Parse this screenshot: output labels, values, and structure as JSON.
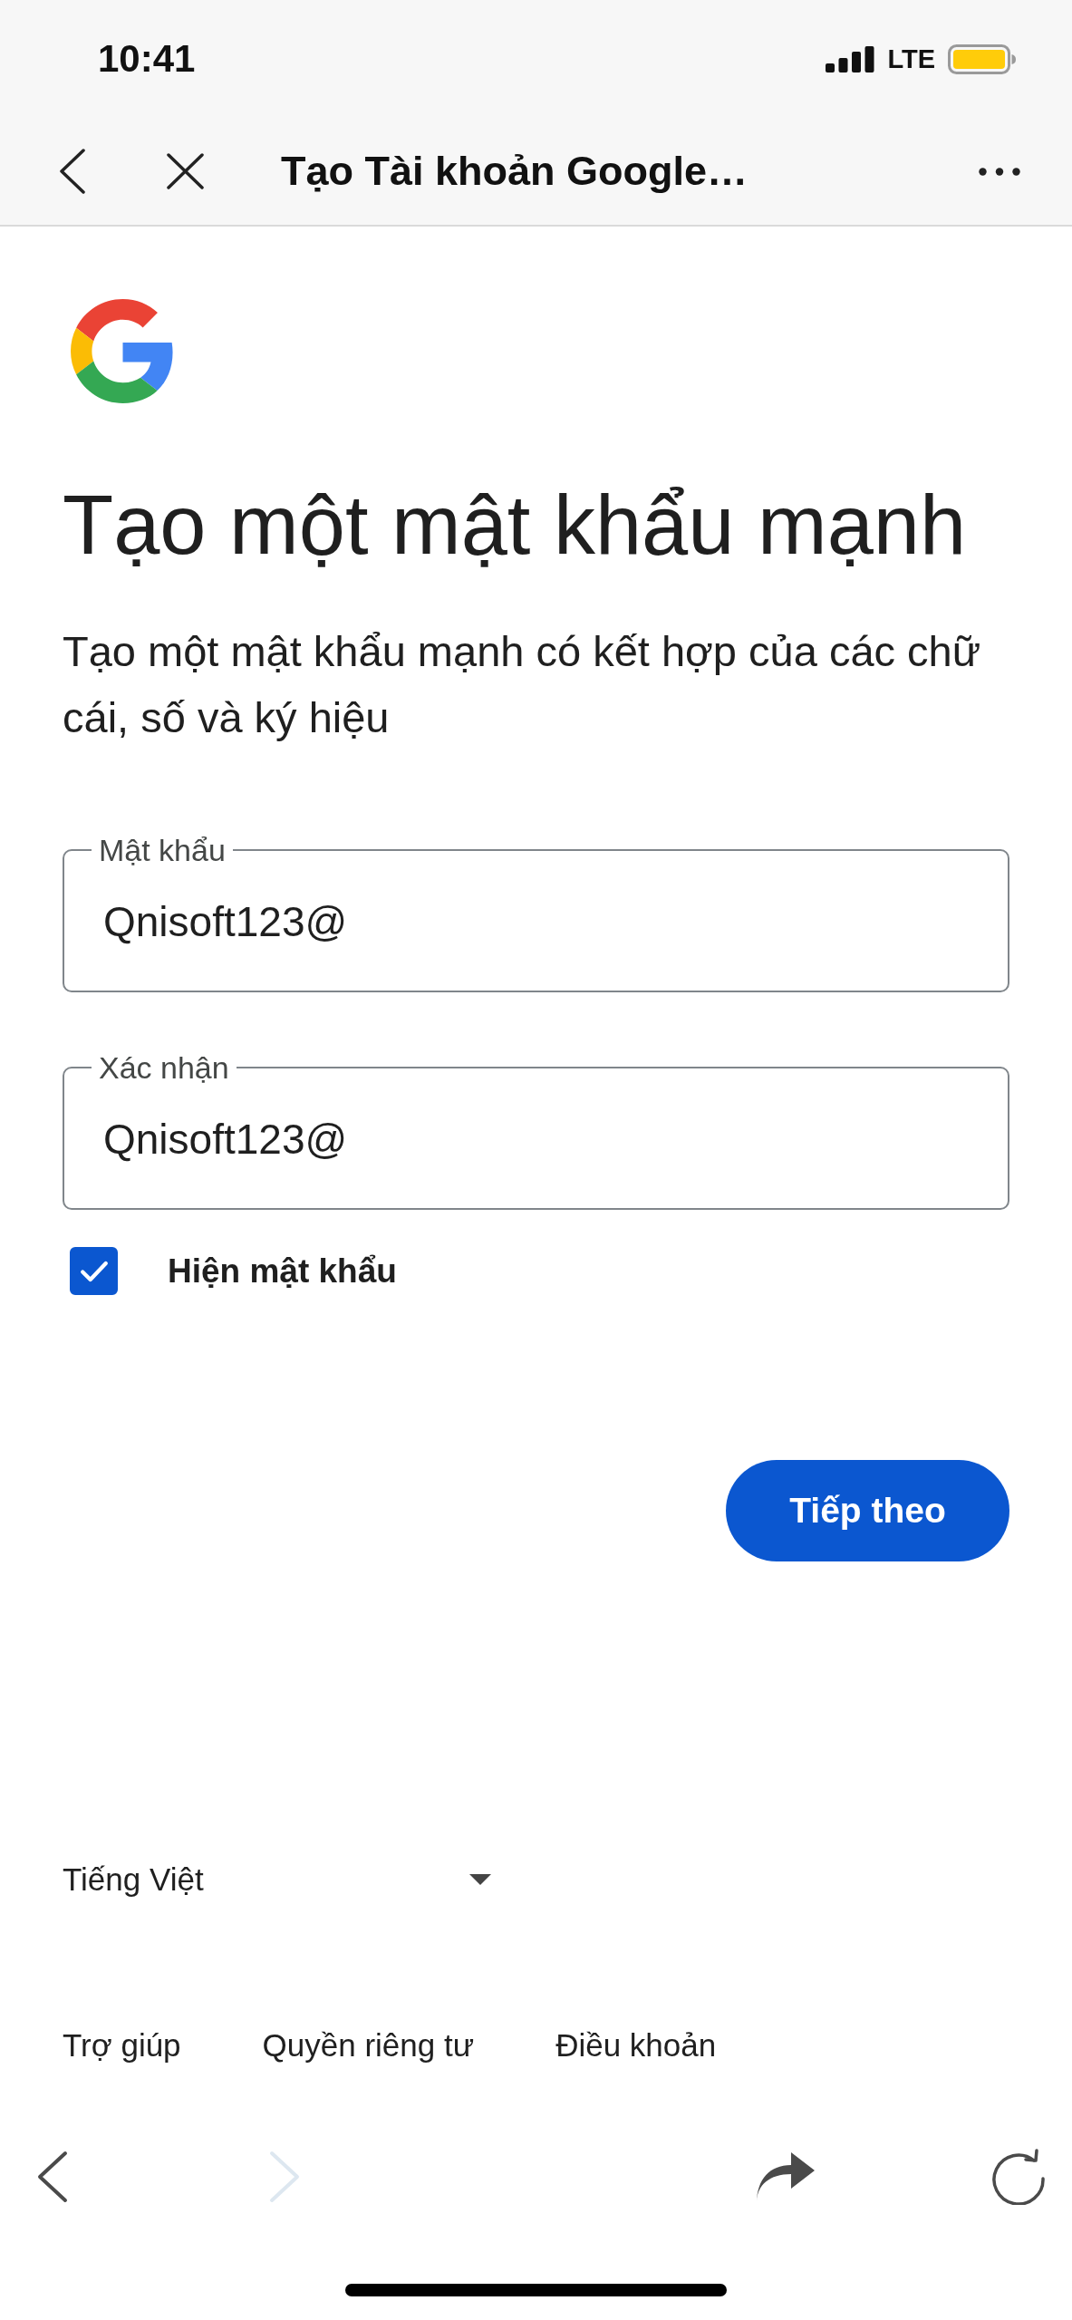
{
  "status_bar": {
    "time": "10:41",
    "network": "LTE"
  },
  "browser_bar": {
    "title": "Tạo Tài khoản Google…"
  },
  "page": {
    "heading": "Tạo một mật khẩu mạnh",
    "description": "Tạo một mật khẩu mạnh có kết hợp của các chữ cái, số và ký hiệu",
    "fields": [
      {
        "label": "Mật khẩu",
        "value": "Qnisoft123@"
      },
      {
        "label": "Xác nhận",
        "value": "Qnisoft123@"
      }
    ],
    "show_password": {
      "label": "Hiện mật khẩu",
      "checked": true
    },
    "next_button": "Tiếp theo"
  },
  "footer": {
    "language": "Tiếng Việt",
    "links": [
      "Trợ giúp",
      "Quyền riêng tư",
      "Điều khoản"
    ]
  },
  "toolbar": [
    {
      "kind": "back",
      "disabled": false
    },
    {
      "kind": "forward",
      "disabled": true
    },
    {
      "kind": "share",
      "disabled": false
    },
    {
      "kind": "reload",
      "disabled": false
    }
  ]
}
